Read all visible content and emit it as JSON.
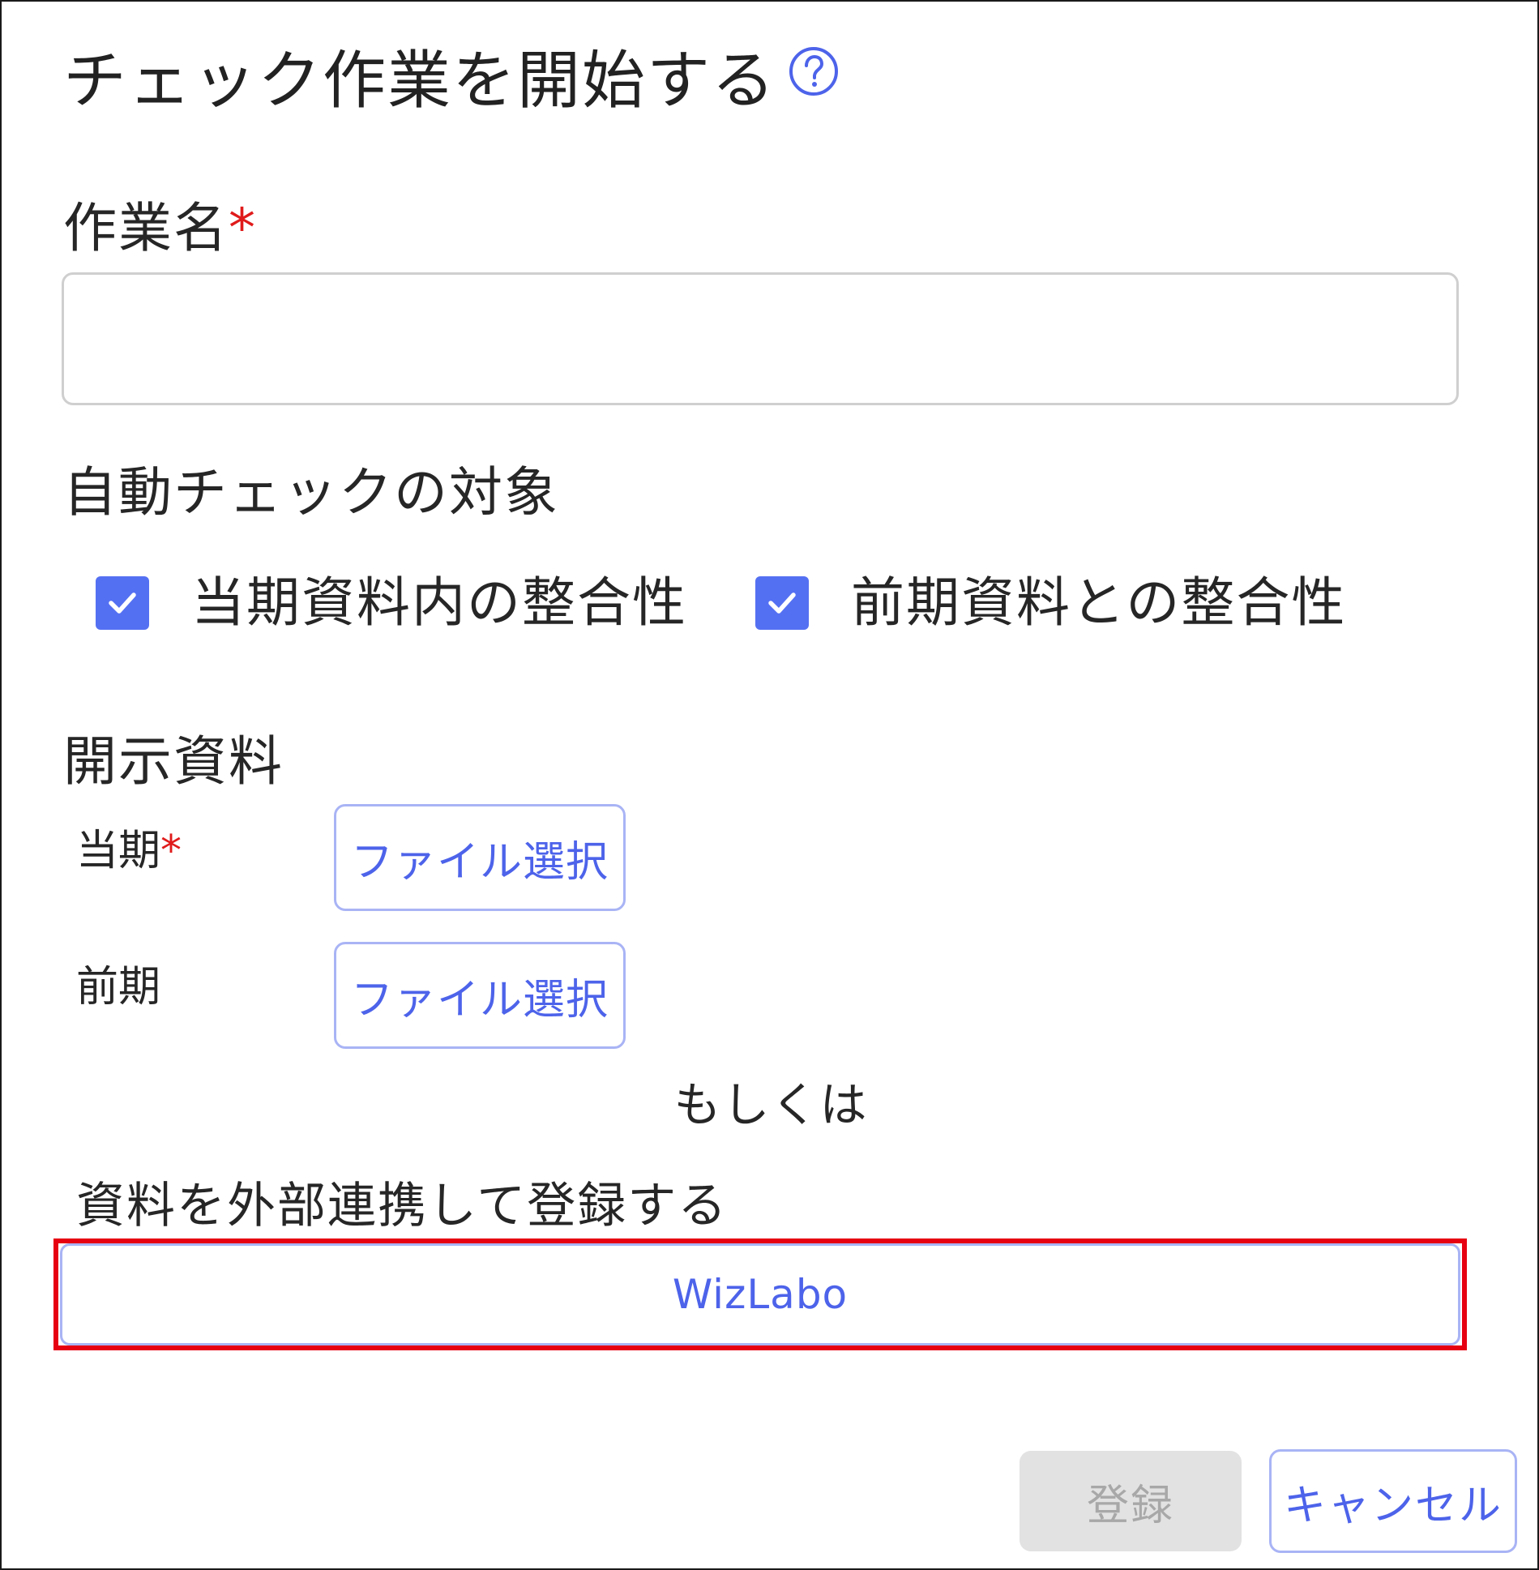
{
  "dialog": {
    "title": "チェック作業を開始する",
    "help_icon": "question-circle-icon"
  },
  "task_name": {
    "label": "作業名",
    "required_mark": "*",
    "value": "",
    "placeholder": ""
  },
  "auto_check": {
    "label": "自動チェックの対象",
    "options": [
      {
        "label": "当期資料内の整合性",
        "checked": true
      },
      {
        "label": "前期資料との整合性",
        "checked": true
      }
    ]
  },
  "disclosure": {
    "label": "開示資料",
    "current": {
      "label": "当期",
      "required_mark": "*",
      "button": "ファイル選択"
    },
    "previous": {
      "label": "前期",
      "button": "ファイル選択"
    }
  },
  "or_text": "もしくは",
  "external": {
    "label": "資料を外部連携して登録する",
    "button": "WizLabo"
  },
  "footer": {
    "register": "登録",
    "cancel": "キャンセル"
  },
  "colors": {
    "accent": "#5470f2",
    "required": "#e01b1b",
    "highlight": "#e60012",
    "disabled_bg": "#e2e2e2"
  }
}
